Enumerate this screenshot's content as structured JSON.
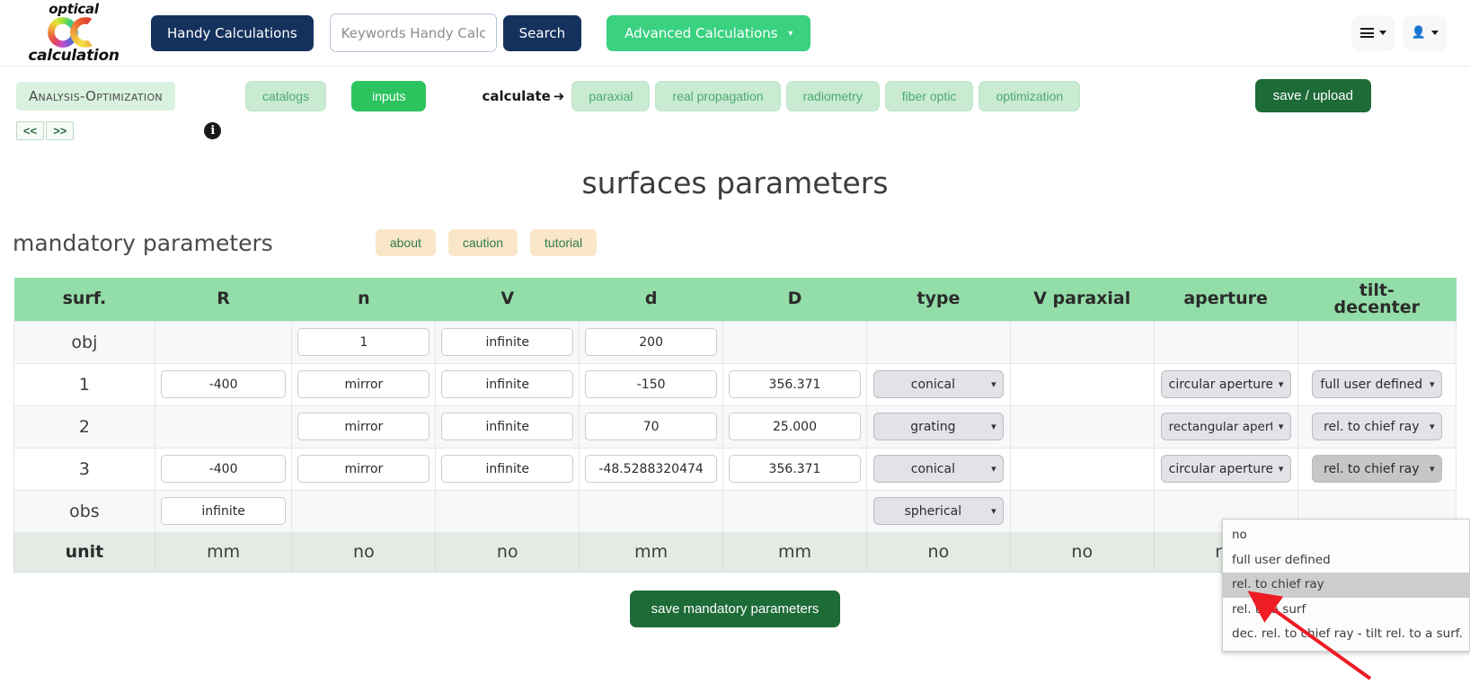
{
  "navbar": {
    "logo_top": "optical",
    "logo_bottom": "calculation",
    "handy_button": "Handy Calculations",
    "search_placeholder": "Keywords Handy Calc...",
    "search_value": "",
    "search_button": "Search",
    "advanced_button": "Advanced Calculations",
    "menu_icon": "hamburger-icon",
    "account_icon": "person-icon"
  },
  "subbar": {
    "module_title": "Analysis-Optimization",
    "catalogs": "catalogs",
    "inputs": "inputs",
    "calculate_label": "calculate",
    "calculate_arrow": "➜",
    "calc_tabs": [
      "paraxial",
      "real propagation",
      "radiometry",
      "fiber optic",
      "optimization"
    ],
    "save_upload": "save / upload",
    "prev": "<<",
    "next": ">>",
    "info_icon": "info-icon"
  },
  "page": {
    "title": "surfaces parameters",
    "section_title": "mandatory parameters",
    "help_buttons": [
      "about",
      "caution",
      "tutorial"
    ],
    "save_mandatory": "save mandatory parameters"
  },
  "table": {
    "headers": [
      "surf.",
      "R",
      "n",
      "V",
      "d",
      "D",
      "type",
      "V paraxial",
      "aperture",
      "tilt-decenter"
    ],
    "header_tilt_line1": "tilt-",
    "header_tilt_line2": "decenter",
    "rows": [
      {
        "surf": "obj",
        "R": null,
        "n": "1",
        "V": "infinite",
        "d": "200",
        "D": null,
        "type": null,
        "Vparaxial": null,
        "aperture": null,
        "tilt": null
      },
      {
        "surf": "1",
        "R": "-400",
        "n": "mirror",
        "V": "infinite",
        "d": "-150",
        "D": "356.371",
        "type": "conical",
        "Vparaxial": null,
        "aperture": "circular aperture",
        "tilt": "full user defined"
      },
      {
        "surf": "2",
        "R": null,
        "n": "mirror",
        "V": "infinite",
        "d": "70",
        "D": "25.000",
        "type": "grating",
        "Vparaxial": null,
        "aperture": "rectangular apertur",
        "tilt": "rel. to chief ray"
      },
      {
        "surf": "3",
        "R": "-400",
        "n": "mirror",
        "V": "infinite",
        "d": "-48.5288320474",
        "D": "356.371",
        "type": "conical",
        "Vparaxial": null,
        "aperture": "circular aperture",
        "tilt": "rel. to chief ray"
      },
      {
        "surf": "obs",
        "R": "infinite",
        "n": null,
        "V": null,
        "d": null,
        "D": null,
        "type": "spherical",
        "Vparaxial": null,
        "aperture": null,
        "tilt": null
      }
    ],
    "unit_row": {
      "label": "unit",
      "values": [
        "mm",
        "no",
        "no",
        "mm",
        "mm",
        "no",
        "no",
        "no",
        ""
      ]
    }
  },
  "dropdown": {
    "open": true,
    "selected": "rel. to chief ray",
    "options": [
      "no",
      "full user defined",
      "rel. to chief ray",
      "rel. to a surf",
      "dec. rel. to chief ray - tilt rel. to a surf."
    ]
  },
  "colors": {
    "navy": "#15325e",
    "green": "#3ad17f",
    "table_header": "#93dda8",
    "dark_green": "#1d6b37",
    "tan": "#fae6c8",
    "arrow_red": "#ee1c25"
  }
}
